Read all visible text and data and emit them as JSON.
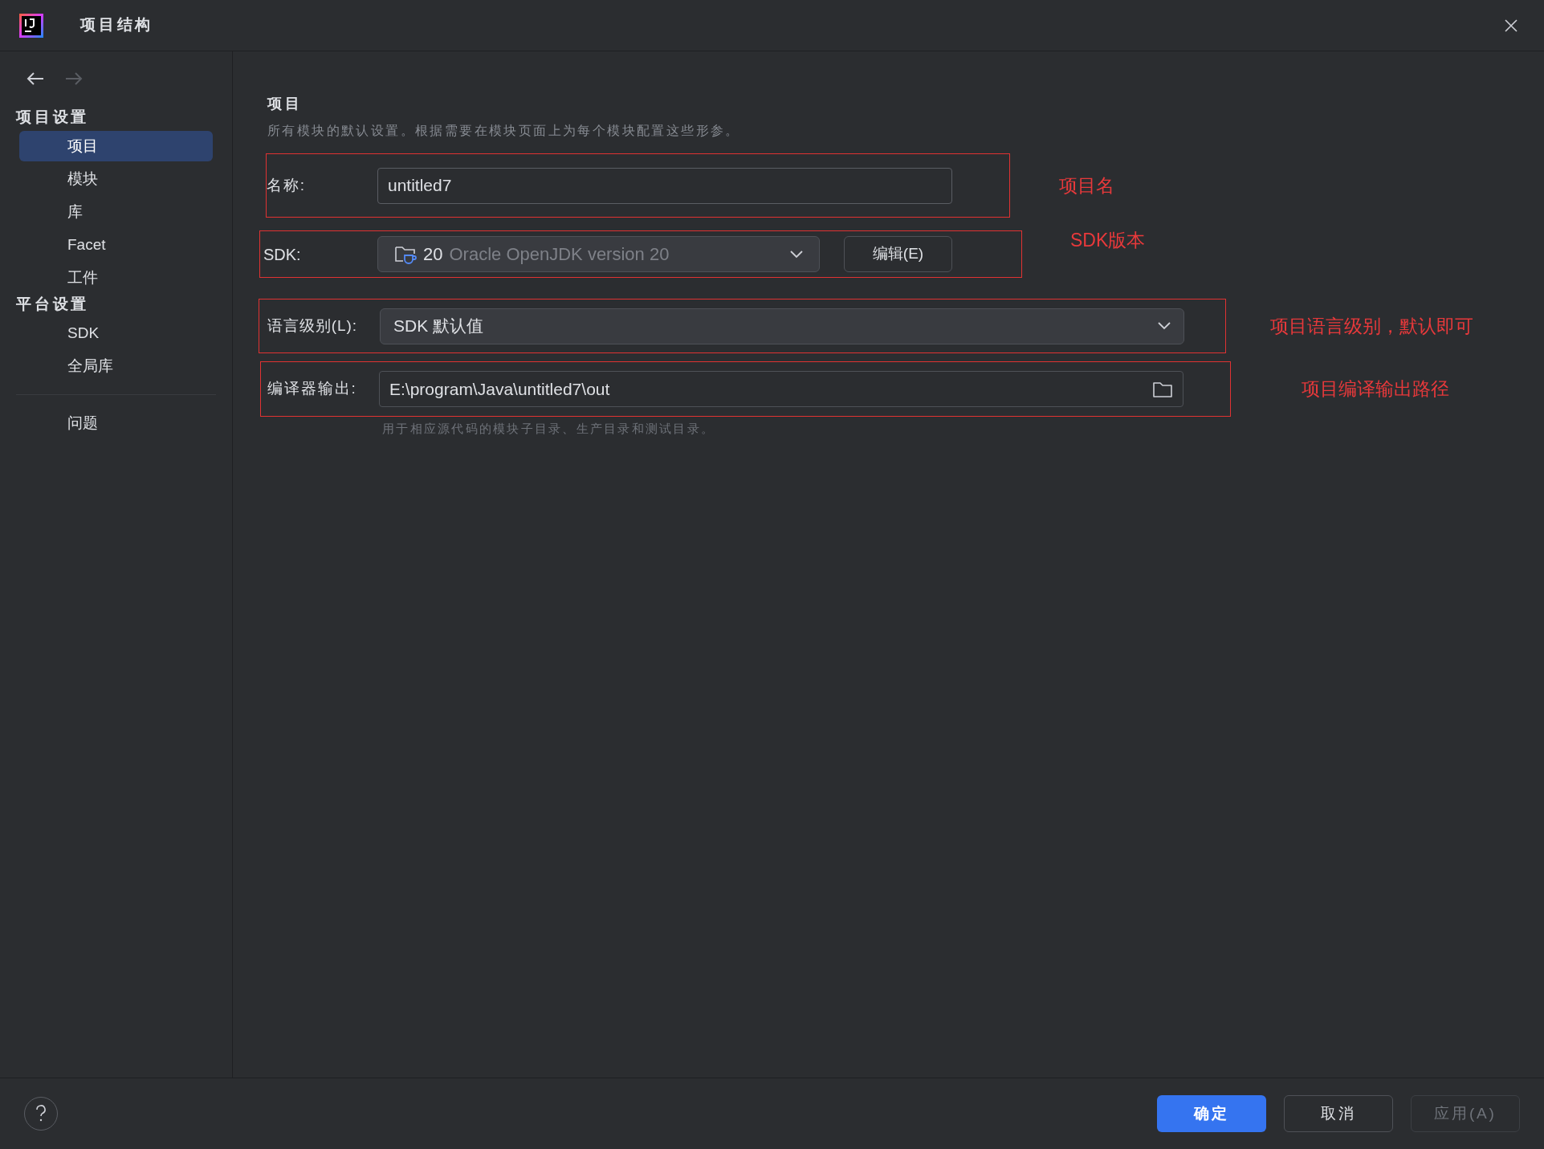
{
  "window": {
    "title": "项目结构"
  },
  "nav": {
    "back_disabled": false,
    "forward_disabled": true
  },
  "sidebar": {
    "sections": [
      {
        "title": "项目设置",
        "items": [
          {
            "label": "项目",
            "selected": true
          },
          {
            "label": "模块",
            "selected": false
          },
          {
            "label": "库",
            "selected": false
          },
          {
            "label": "Facet",
            "selected": false
          },
          {
            "label": "工件",
            "selected": false
          }
        ]
      },
      {
        "title": "平台设置",
        "items": [
          {
            "label": "SDK",
            "selected": false
          },
          {
            "label": "全局库",
            "selected": false
          }
        ]
      }
    ],
    "footer_items": [
      {
        "label": "问题",
        "selected": false
      }
    ]
  },
  "content": {
    "heading": "项目",
    "description": "所有模块的默认设置。根据需要在模块页面上为每个模块配置这些形参。",
    "name": {
      "label": "名称:",
      "value": "untitled7",
      "annotation": "项目名"
    },
    "sdk": {
      "label": "SDK:",
      "version": "20",
      "name": "Oracle OpenJDK version 20",
      "edit_button": "编辑(E)",
      "annotation": "SDK版本"
    },
    "language_level": {
      "label": "语言级别(L):",
      "value": "SDK 默认值",
      "annotation": "项目语言级别，默认即可"
    },
    "compiler_output": {
      "label": "编译器输出:",
      "value": "E:\\program\\Java\\untitled7\\out",
      "hint": "用于相应源代码的模块子目录、生产目录和测试目录。",
      "annotation": "项目编译输出路径"
    }
  },
  "buttons": [
    {
      "label": "确定",
      "kind": "primary",
      "disabled": false
    },
    {
      "label": "取消",
      "kind": "normal",
      "disabled": false
    },
    {
      "label": "应用(A)",
      "kind": "normal",
      "disabled": true
    }
  ]
}
